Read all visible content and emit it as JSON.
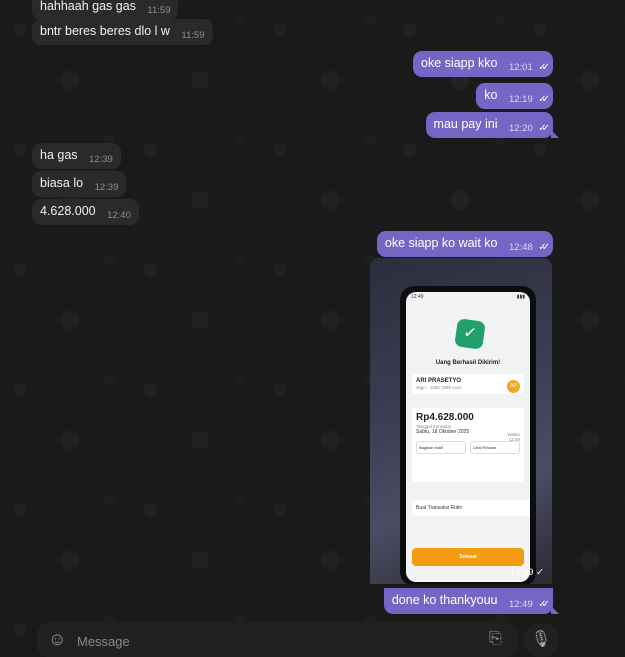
{
  "messages": [
    {
      "id": "m1",
      "dir": "in",
      "text": "hahhaah gas gas",
      "time": "11:59"
    },
    {
      "id": "m2",
      "dir": "in",
      "text": "bntr beres beres dlo l w",
      "time": "11:59"
    },
    {
      "id": "m3",
      "dir": "out",
      "text": "oke siapp kko",
      "time": "12:01"
    },
    {
      "id": "m4",
      "dir": "out",
      "text": "ko",
      "time": "12:19"
    },
    {
      "id": "m5",
      "dir": "out",
      "text": "mau pay ini",
      "time": "12:20"
    },
    {
      "id": "m6",
      "dir": "in",
      "text": "ha gas",
      "time": "12:39"
    },
    {
      "id": "m7",
      "dir": "in",
      "text": "biasa lo",
      "time": "12:39"
    },
    {
      "id": "m8",
      "dir": "in",
      "text": "4.628.000",
      "time": "12:40"
    },
    {
      "id": "m9",
      "dir": "out",
      "text": "oke siapp ko wait ko",
      "time": "12:48"
    },
    {
      "id": "m10",
      "dir": "out",
      "text": "done ko thankyouu",
      "time": "12:49"
    }
  ],
  "read_ticks": "✓✓",
  "photo": {
    "time": "12:49",
    "tick": "✓",
    "screen": {
      "status_time": "12:49",
      "title": "Uang Berhasil Dikirim!",
      "recipient_name": "ARI PRASETYO",
      "recipient_sub": "Jago · 1060 7898 xxxx",
      "recipient_initials": "AP",
      "amount": "Rp4.628.000",
      "date_label": "Tanggal transaksi",
      "date_value": "Sabtu, 18 Oktober 2025",
      "time_label": "Waktu",
      "time_value": "12:49",
      "share_label": "Bagikan bukti",
      "receipt_label": "Lihat Rincian",
      "repeat_label": "Buat Transaksi Rutin",
      "done_label": "Selesai"
    }
  },
  "composer": {
    "placeholder": "Message",
    "emoji_icon": "emoji-icon",
    "attach_icon": "paperclip-icon",
    "mic_icon": "microphone-icon"
  }
}
